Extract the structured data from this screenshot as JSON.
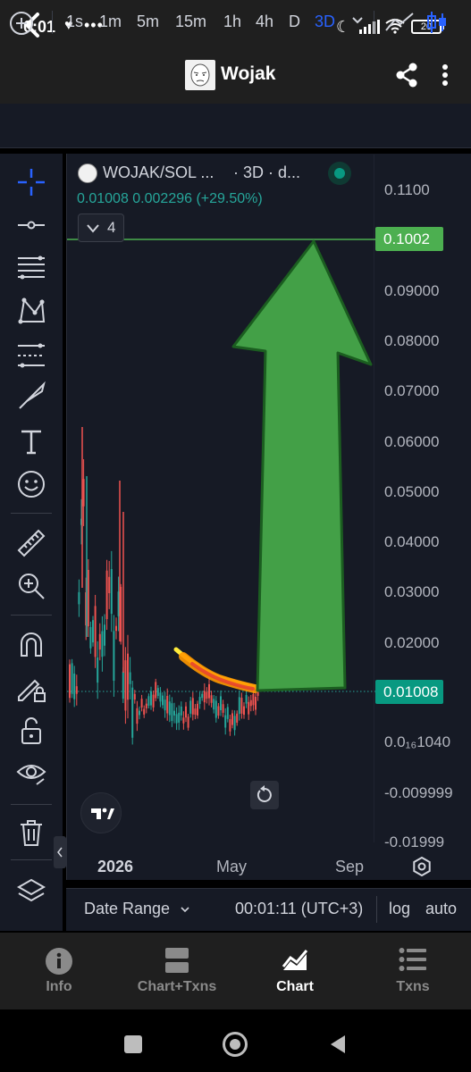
{
  "status_bar": {
    "time": "0:01",
    "battery": "20"
  },
  "app_bar": {
    "title": "Wojak"
  },
  "toolbar": {
    "intervals": [
      "1s",
      "1m",
      "5m",
      "15m",
      "1h",
      "4h",
      "D",
      "3D"
    ],
    "active_interval": "3D"
  },
  "chart": {
    "legend": {
      "symbol": "WOJAK/SOL ...",
      "interval": "· 3D · d...",
      "values": "0.01008  0.002296 (+29.50%)",
      "indicators_count": "4"
    },
    "price_ticks": [
      "0.1100",
      "0.09000",
      "0.08000",
      "0.07000",
      "0.06000",
      "0.05000",
      "0.04000",
      "0.03000",
      "0.02000",
      "0.0₁₆1040",
      "-0.009999",
      "-0.01999"
    ],
    "target_price": "0.1002",
    "current_price": "0.01008",
    "time_labels": [
      "2026",
      "May",
      "Sep"
    ],
    "colors": {
      "up": "#26a69a",
      "down": "#ef5350",
      "target_line": "#4caf50",
      "arrow_fill": "#43a047",
      "highlight": "#ff9800"
    }
  },
  "bottom_toolbar": {
    "date_range": "Date Range",
    "clock": "00:01:11 (UTC+3)",
    "log": "log",
    "auto": "auto"
  },
  "bottom_nav": [
    {
      "label": "Info",
      "icon": "info-icon"
    },
    {
      "label": "Chart+Txns",
      "icon": "chart-txns-icon"
    },
    {
      "label": "Chart",
      "icon": "chart-icon",
      "active": true
    },
    {
      "label": "Txns",
      "icon": "list-icon"
    }
  ]
}
